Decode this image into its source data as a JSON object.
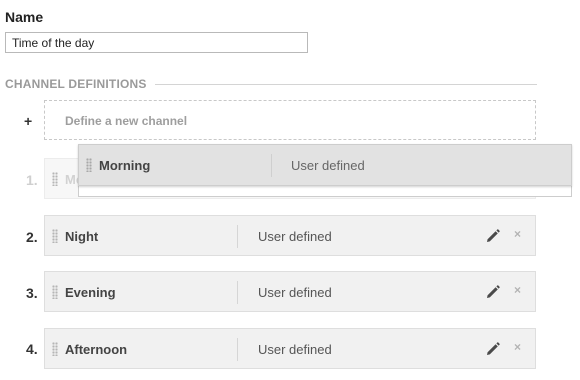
{
  "form": {
    "name_label": "Name",
    "name_value": "Time of the day"
  },
  "section": {
    "title": "CHANNEL DEFINITIONS"
  },
  "define_new": {
    "plus": "+",
    "label": "Define a new channel"
  },
  "dragging_item": {
    "name": "Morning",
    "type": "User defined"
  },
  "channels": [
    {
      "number": "1.",
      "name": "Morning",
      "type": "User defined",
      "placeholder": true
    },
    {
      "number": "2.",
      "name": "Night",
      "type": "User defined"
    },
    {
      "number": "3.",
      "name": "Evening",
      "type": "User defined"
    },
    {
      "number": "4.",
      "name": "Afternoon",
      "type": "User defined"
    }
  ],
  "icons": {
    "drag_handle": "drag-handle-icon",
    "edit": "pencil-icon",
    "delete": "close-icon",
    "delete_glyph": "×"
  }
}
